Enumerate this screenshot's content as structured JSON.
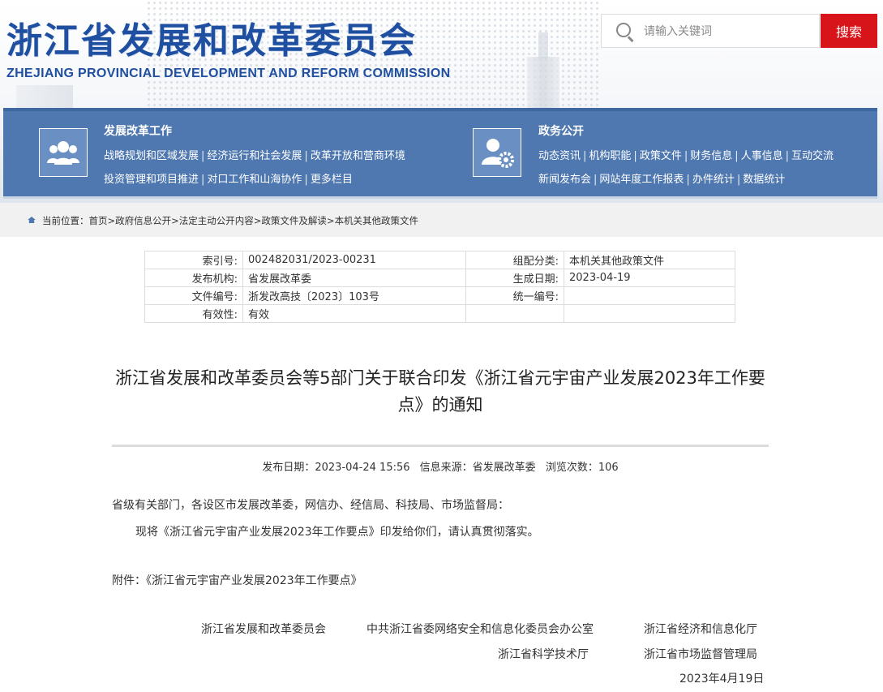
{
  "header": {
    "title": "浙江省发展和改革委员会",
    "subtitle": "ZHEJIANG PROVINCIAL DEVELOPMENT AND REFORM COMMISSION"
  },
  "search": {
    "placeholder": "请输入关键词",
    "button_label": "搜索"
  },
  "nav": {
    "col1": {
      "title": "发展改革工作",
      "line1": [
        "战略规划和区域发展",
        "经济运行和社会发展",
        "改革开放和营商环境"
      ],
      "line2": [
        "投资管理和项目推进",
        "对口工作和山海协作",
        "更多栏目"
      ]
    },
    "col2": {
      "title": "政务公开",
      "line1": [
        "动态资讯",
        "机构职能",
        "政策文件",
        "财务信息",
        "人事信息",
        "互动交流"
      ],
      "line2": [
        "新闻发布会",
        "网站年度工作报表",
        "办件统计",
        "数据统计"
      ]
    }
  },
  "breadcrumb": {
    "prefix": "当前位置：",
    "items": [
      "首页",
      "政府信息公开",
      "法定主动公开内容",
      "政策文件及解读",
      "本机关其他政策文件"
    ]
  },
  "meta": [
    {
      "l1": "索引号:",
      "v1": "002482031/2023-00231",
      "l2": "组配分类:",
      "v2": "本机关其他政策文件"
    },
    {
      "l1": "发布机构:",
      "v1": "省发展改革委",
      "l2": "生成日期:",
      "v2": "2023-04-19"
    },
    {
      "l1": "文件编号:",
      "v1": "浙发改高技〔2023〕103号",
      "l2": "统一编号:",
      "v2": ""
    },
    {
      "l1": "有效性:",
      "v1": "有效",
      "l2": "",
      "v2": ""
    }
  ],
  "article": {
    "title": "浙江省发展和改革委员会等5部门关于联合印发《浙江省元宇宙产业发展2023年工作要点》的通知",
    "publish_date": "发布日期：2023-04-24 15:56",
    "source": "信息来源：省发展改革委",
    "views": "浏览次数：106",
    "salutation": "省级有关部门，各设区市发展改革委，网信办、经信局、科技局、市场监督局：",
    "paragraph": "现将《浙江省元宇宙产业发展2023年工作要点》印发给你们，请认真贯彻落实。",
    "attachment": "附件：《浙江省元宇宙产业发展2023年工作要点》",
    "signatories": [
      "浙江省发展和改革委员会",
      "中共浙江省委网络安全和信息化委员会办公室",
      "浙江省经济和信息化厅",
      "浙江省科学技术厅",
      "浙江省市场监督管理局"
    ],
    "date": "2023年4月19日"
  }
}
